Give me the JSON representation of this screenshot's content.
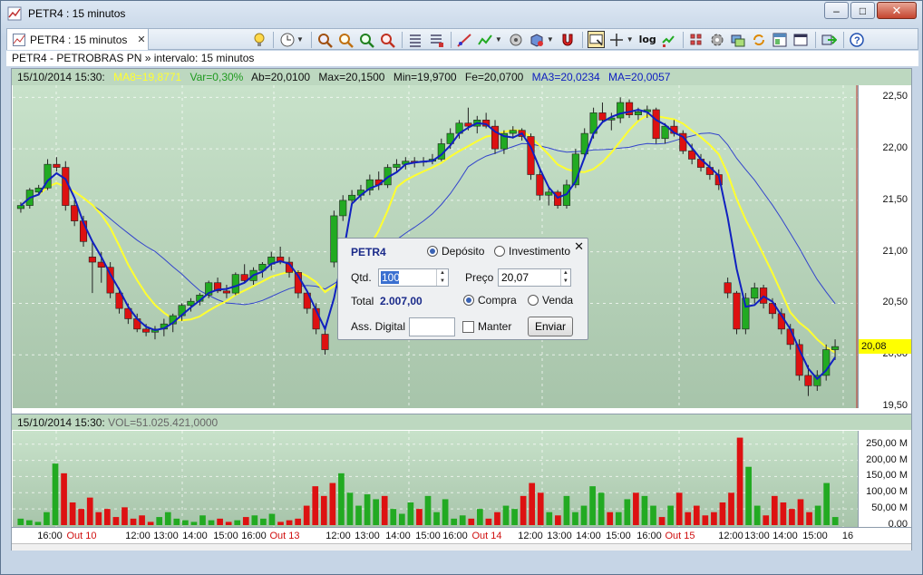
{
  "window": {
    "title": "PETR4 : 15 minutos",
    "min_glyph": "–",
    "max_glyph": "□",
    "close_glyph": "✕"
  },
  "tab": {
    "label": "PETR4 : 15 minutos",
    "close_glyph": "✕"
  },
  "toolbar": {
    "icons": [
      "lightbulb-icon",
      "clock-icon",
      "zoom-in-icon",
      "zoom-out-icon",
      "zoom-fit-icon",
      "zoom-reset-icon",
      "list-icon",
      "list-alt-icon",
      "line-tool-icon",
      "indicator-icon",
      "wheel-icon",
      "cube-icon",
      "magnet-icon",
      "select-box-icon",
      "crosshair-icon",
      "log-scale-icon",
      "trade-icon",
      "grid-icon",
      "settings-icon",
      "layers-icon",
      "sync-icon",
      "layout-icon",
      "window-icon",
      "export-icon",
      "help-icon"
    ],
    "log_label": "log"
  },
  "subtitle": "PETR4 - PETROBRAS PN » intervalo: 15 minutos",
  "infobar": {
    "datetime": "15/10/2014 15:30:",
    "ma8": "MA8=19,8771",
    "var": "Var=0,30%",
    "ab": "Ab=20,0100",
    "max": "Max=20,1500",
    "min": "Min=19,9700",
    "fe": "Fe=20,0700",
    "ma3": "MA3=20,0234",
    "ma": "MA=20,0057"
  },
  "volinfo": {
    "datetime": "15/10/2014 15:30:",
    "vol": "VOL=51.025.421,0000"
  },
  "price_axis": {
    "ticks": [
      "22,50",
      "22,00",
      "21,50",
      "21,00",
      "20,50",
      "20,00",
      "19,50"
    ],
    "current": "20,08"
  },
  "vol_axis": {
    "ticks": [
      "250,00 M",
      "200,00 M",
      "150,00 M",
      "100,00 M",
      "50,00 M",
      "0,00"
    ]
  },
  "x_axis": [
    {
      "t": "16:00",
      "date": false
    },
    {
      "t": "Out 10",
      "date": true
    },
    {
      "t": "12:00",
      "date": false
    },
    {
      "t": "13:00",
      "date": false
    },
    {
      "t": "14:00",
      "date": false
    },
    {
      "t": "15:00",
      "date": false
    },
    {
      "t": "16:00",
      "date": false
    },
    {
      "t": "Out 13",
      "date": true
    },
    {
      "t": "12:00",
      "date": false
    },
    {
      "t": "13:00",
      "date": false
    },
    {
      "t": "14:00",
      "date": false
    },
    {
      "t": "15:00",
      "date": false
    },
    {
      "t": "16:00",
      "date": false
    },
    {
      "t": "Out 14",
      "date": true
    },
    {
      "t": "12:00",
      "date": false
    },
    {
      "t": "13:00",
      "date": false
    },
    {
      "t": "14:00",
      "date": false
    },
    {
      "t": "15:00",
      "date": false
    },
    {
      "t": "16:00",
      "date": false
    },
    {
      "t": "Out 15",
      "date": true
    },
    {
      "t": "12:00",
      "date": false
    },
    {
      "t": "13:00",
      "date": false
    },
    {
      "t": "14:00",
      "date": false
    },
    {
      "t": "15:00",
      "date": false
    },
    {
      "t": "16",
      "date": false
    }
  ],
  "colors": {
    "up": "#22aa22",
    "down": "#dd1111",
    "ma_fast": "#1020c0",
    "ma_mid": "#ffff30",
    "ma_slow": "#3344cc",
    "ma8": "#ffff30",
    "var": "#22aa22",
    "ma3": "#1020c0",
    "ma": "#1020c0"
  },
  "chart_data": {
    "type": "candlestick",
    "title": "PETR4 - PETROBRAS PN",
    "ylim": [
      19.5,
      22.6
    ],
    "candles_ohlc": [
      [
        21.42,
        21.48,
        21.38,
        21.45
      ],
      [
        21.45,
        21.62,
        21.42,
        21.6
      ],
      [
        21.58,
        21.65,
        21.55,
        21.62
      ],
      [
        21.62,
        21.9,
        21.6,
        21.85
      ],
      [
        21.85,
        21.92,
        21.78,
        21.82
      ],
      [
        21.82,
        21.88,
        21.4,
        21.45
      ],
      [
        21.45,
        21.5,
        21.25,
        21.3
      ],
      [
        21.3,
        21.35,
        21.05,
        21.1
      ],
      [
        20.95,
        21.1,
        20.6,
        20.9
      ],
      [
        20.9,
        21.0,
        20.7,
        20.85
      ],
      [
        20.85,
        20.9,
        20.55,
        20.6
      ],
      [
        20.6,
        20.65,
        20.4,
        20.45
      ],
      [
        20.45,
        20.5,
        20.3,
        20.35
      ],
      [
        20.35,
        20.4,
        20.22,
        20.25
      ],
      [
        20.25,
        20.3,
        20.18,
        20.22
      ],
      [
        20.22,
        20.28,
        20.15,
        20.25
      ],
      [
        20.25,
        20.35,
        20.18,
        20.3
      ],
      [
        20.3,
        20.4,
        20.22,
        20.38
      ],
      [
        20.38,
        20.5,
        20.33,
        20.48
      ],
      [
        20.48,
        20.55,
        20.42,
        20.52
      ],
      [
        20.52,
        20.6,
        20.48,
        20.58
      ],
      [
        20.58,
        20.72,
        20.55,
        20.7
      ],
      [
        20.7,
        20.75,
        20.6,
        20.62
      ],
      [
        20.62,
        20.68,
        20.55,
        20.6
      ],
      [
        20.6,
        20.8,
        20.58,
        20.78
      ],
      [
        20.78,
        20.88,
        20.7,
        20.72
      ],
      [
        20.72,
        20.85,
        20.68,
        20.82
      ],
      [
        20.82,
        20.9,
        20.75,
        20.88
      ],
      [
        20.88,
        21.0,
        20.82,
        20.95
      ],
      [
        20.95,
        21.05,
        20.88,
        20.9
      ],
      [
        20.9,
        20.95,
        20.75,
        20.8
      ],
      [
        20.8,
        20.82,
        20.55,
        20.6
      ],
      [
        20.6,
        20.62,
        20.4,
        20.45
      ],
      [
        20.45,
        20.5,
        20.2,
        20.25
      ],
      [
        20.2,
        20.28,
        20.0,
        20.05
      ],
      [
        20.9,
        21.4,
        20.85,
        21.35
      ],
      [
        21.35,
        21.55,
        21.3,
        21.5
      ],
      [
        21.5,
        21.6,
        21.45,
        21.55
      ],
      [
        21.55,
        21.65,
        21.5,
        21.6
      ],
      [
        21.6,
        21.75,
        21.55,
        21.7
      ],
      [
        21.7,
        21.78,
        21.6,
        21.65
      ],
      [
        21.65,
        21.85,
        21.62,
        21.82
      ],
      [
        21.82,
        21.9,
        21.78,
        21.85
      ],
      [
        21.85,
        21.92,
        21.8,
        21.88
      ],
      [
        21.88,
        21.92,
        21.82,
        21.87
      ],
      [
        21.87,
        21.92,
        21.83,
        21.88
      ],
      [
        21.88,
        21.95,
        21.85,
        21.9
      ],
      [
        21.9,
        22.1,
        21.88,
        22.05
      ],
      [
        22.05,
        22.2,
        22.0,
        22.15
      ],
      [
        22.15,
        22.28,
        22.1,
        22.25
      ],
      [
        22.25,
        22.4,
        22.18,
        22.22
      ],
      [
        22.22,
        22.32,
        22.15,
        22.28
      ],
      [
        22.28,
        22.35,
        22.2,
        22.22
      ],
      [
        22.22,
        22.28,
        21.95,
        22.0
      ],
      [
        22.0,
        22.18,
        21.95,
        22.15
      ],
      [
        22.15,
        22.22,
        22.1,
        22.18
      ],
      [
        22.18,
        22.2,
        22.08,
        22.12
      ],
      [
        22.12,
        22.15,
        21.7,
        21.75
      ],
      [
        21.75,
        21.8,
        21.5,
        21.55
      ],
      [
        21.55,
        21.62,
        21.45,
        21.58
      ],
      [
        21.58,
        21.6,
        21.42,
        21.45
      ],
      [
        21.45,
        21.7,
        21.42,
        21.65
      ],
      [
        21.65,
        22.0,
        21.62,
        21.95
      ],
      [
        21.95,
        22.2,
        21.9,
        22.15
      ],
      [
        22.15,
        22.4,
        22.1,
        22.35
      ],
      [
        22.35,
        22.45,
        22.25,
        22.28
      ],
      [
        22.28,
        22.35,
        22.18,
        22.3
      ],
      [
        22.3,
        22.5,
        22.25,
        22.45
      ],
      [
        22.45,
        22.48,
        22.3,
        22.33
      ],
      [
        22.33,
        22.4,
        22.28,
        22.36
      ],
      [
        22.36,
        22.42,
        22.3,
        22.38
      ],
      [
        22.38,
        22.4,
        22.05,
        22.1
      ],
      [
        22.1,
        22.25,
        22.05,
        22.22
      ],
      [
        22.22,
        22.28,
        22.12,
        22.15
      ],
      [
        22.15,
        22.18,
        21.95,
        21.98
      ],
      [
        21.98,
        22.05,
        21.85,
        21.9
      ],
      [
        21.9,
        21.95,
        21.78,
        21.82
      ],
      [
        21.82,
        21.88,
        21.7,
        21.75
      ],
      [
        21.75,
        21.8,
        21.6,
        21.65
      ],
      [
        20.7,
        20.75,
        20.55,
        20.6
      ],
      [
        20.6,
        20.62,
        20.2,
        20.25
      ],
      [
        20.25,
        20.6,
        20.2,
        20.55
      ],
      [
        20.55,
        20.7,
        20.5,
        20.65
      ],
      [
        20.65,
        20.68,
        20.45,
        20.5
      ],
      [
        20.5,
        20.55,
        20.35,
        20.4
      ],
      [
        20.4,
        20.45,
        20.2,
        20.25
      ],
      [
        20.25,
        20.3,
        20.05,
        20.1
      ],
      [
        20.1,
        20.15,
        19.75,
        19.8
      ],
      [
        19.8,
        19.9,
        19.6,
        19.7
      ],
      [
        19.7,
        19.85,
        19.65,
        19.8
      ],
      [
        19.8,
        20.1,
        19.75,
        20.05
      ],
      [
        20.05,
        20.15,
        19.95,
        20.08
      ]
    ],
    "volume_millions": [
      20,
      15,
      10,
      40,
      190,
      160,
      70,
      50,
      85,
      40,
      50,
      25,
      55,
      20,
      30,
      10,
      25,
      40,
      20,
      15,
      10,
      30,
      15,
      20,
      10,
      15,
      25,
      30,
      20,
      35,
      10,
      15,
      20,
      60,
      120,
      90,
      130,
      160,
      100,
      60,
      95,
      80,
      90,
      50,
      35,
      70,
      50,
      90,
      40,
      80,
      20,
      30,
      20,
      50,
      20,
      40,
      60,
      50,
      90,
      130,
      100,
      40,
      30,
      90,
      40,
      60,
      120,
      100,
      40,
      40,
      80,
      100,
      90,
      60,
      25,
      60,
      100,
      40,
      60,
      30,
      40,
      70,
      100,
      270,
      180,
      60,
      30,
      90,
      70,
      50,
      80,
      40,
      60,
      130,
      25
    ]
  },
  "dialog": {
    "ticker": "PETR4",
    "close_glyph": "✕",
    "mode_deposito": "Depósito",
    "mode_investimento": "Investimento",
    "qtd_label": "Qtd.",
    "qtd_value": "100",
    "preco_label": "Preço",
    "preco_value": "20,07",
    "total_label": "Total",
    "total_value": "2.007,00",
    "side_compra": "Compra",
    "side_venda": "Venda",
    "ass_label": "Ass. Digital",
    "manter_label": "Manter",
    "enviar_label": "Enviar"
  }
}
